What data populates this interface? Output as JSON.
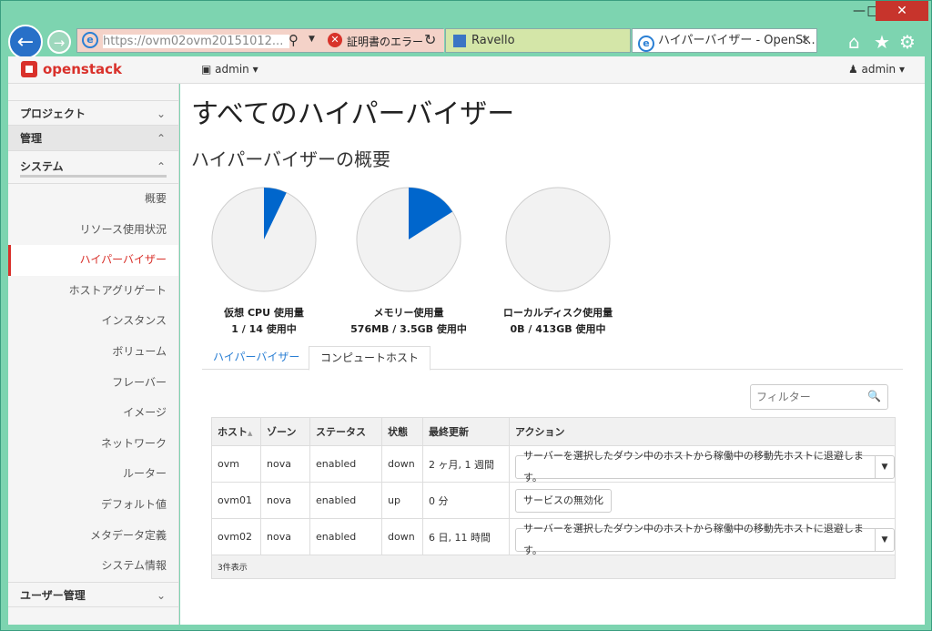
{
  "browser": {
    "address_url": "https://ovm02ovm20151012...",
    "cert_error": "証明書のエラー",
    "tabs": [
      {
        "label": "Ravello"
      },
      {
        "label": "ハイパーバイザー - OpenSt..."
      }
    ]
  },
  "header": {
    "logo": "openstack",
    "project": "admin",
    "user": "admin"
  },
  "sidebar": {
    "project": "プロジェクト",
    "admin": "管理",
    "system": "システム",
    "items": [
      {
        "label": "概要"
      },
      {
        "label": "リソース使用状況"
      },
      {
        "label": "ハイパーバイザー"
      },
      {
        "label": "ホストアグリゲート"
      },
      {
        "label": "インスタンス"
      },
      {
        "label": "ボリューム"
      },
      {
        "label": "フレーバー"
      },
      {
        "label": "イメージ"
      },
      {
        "label": "ネットワーク"
      },
      {
        "label": "ルーター"
      },
      {
        "label": "デフォルト値"
      },
      {
        "label": "メタデータ定義"
      },
      {
        "label": "システム情報"
      }
    ],
    "user_admin": "ユーザー管理"
  },
  "main": {
    "title": "すべてのハイパーバイザー",
    "overview": "ハイパーバイザーの概要",
    "pies": [
      {
        "title": "仮想 CPU 使用量",
        "sub": "1 / 14 使用中",
        "fraction": 0.0714
      },
      {
        "title": "メモリー使用量",
        "sub": "576MB / 3.5GB 使用中",
        "fraction": 0.16
      },
      {
        "title": "ローカルディスク使用量",
        "sub": "0B / 413GB 使用中",
        "fraction": 0
      }
    ],
    "tabs": {
      "hypervisors": "ハイパーバイザー",
      "compute_hosts": "コンピュートホスト"
    },
    "filter_placeholder": "フィルター",
    "table": {
      "headers": [
        "ホスト",
        "ゾーン",
        "ステータス",
        "状態",
        "最終更新",
        "アクション"
      ],
      "rows": [
        {
          "host": "ovm",
          "zone": "nova",
          "status": "enabled",
          "state": "down",
          "updated": "2 ヶ月, 1 週間",
          "action": "サーバーを選択したダウン中のホストから稼働中の移動先ホストに退避します。",
          "dropdown": true
        },
        {
          "host": "ovm01",
          "zone": "nova",
          "status": "enabled",
          "state": "up",
          "updated": "0 分",
          "action": "サービスの無効化",
          "dropdown": false
        },
        {
          "host": "ovm02",
          "zone": "nova",
          "status": "enabled",
          "state": "down",
          "updated": "6 日, 11 時間",
          "action": "サーバーを選択したダウン中のホストから稼働中の移動先ホストに退避します。",
          "dropdown": true
        }
      ],
      "footer": "3件表示"
    }
  },
  "colors": {
    "accent": "#d9312b",
    "pie_fill": "#0066cc",
    "pie_bg": "#f2f2f2"
  }
}
